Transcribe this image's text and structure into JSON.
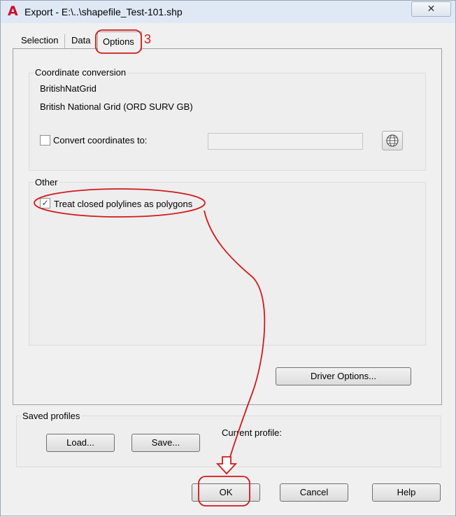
{
  "window": {
    "title": "Export - E:\\..\\shapefile_Test-101.shp",
    "app_icon_glyph": "A",
    "close_glyph": "✕"
  },
  "tabs": [
    {
      "label": "Selection",
      "active": false
    },
    {
      "label": "Data",
      "active": false
    },
    {
      "label": "Options",
      "active": true
    }
  ],
  "coordinate_conversion": {
    "group_label": "Coordinate conversion",
    "code": "BritishNatGrid",
    "description": "British National Grid (ORD SURV GB)",
    "convert_label": "Convert coordinates to:",
    "convert_checked": false,
    "convert_value": "",
    "globe_icon": "globe-icon"
  },
  "other": {
    "group_label": "Other",
    "treat_label": "Treat closed polylines as polygons",
    "treat_checked": true
  },
  "driver_options_label": "Driver Options...",
  "saved_profiles": {
    "group_label": "Saved profiles",
    "load_label": "Load...",
    "save_label": "Save...",
    "current_profile_label": "Current profile:"
  },
  "footer": {
    "ok_label": "OK",
    "cancel_label": "Cancel",
    "help_label": "Help"
  },
  "annotation": {
    "step_number": "3",
    "color": "#d11a1a"
  },
  "colors": {
    "titlebar": "#dfe9f5",
    "dialog_bg": "#f0f0f0",
    "checkmark": "#1f3f7a"
  }
}
